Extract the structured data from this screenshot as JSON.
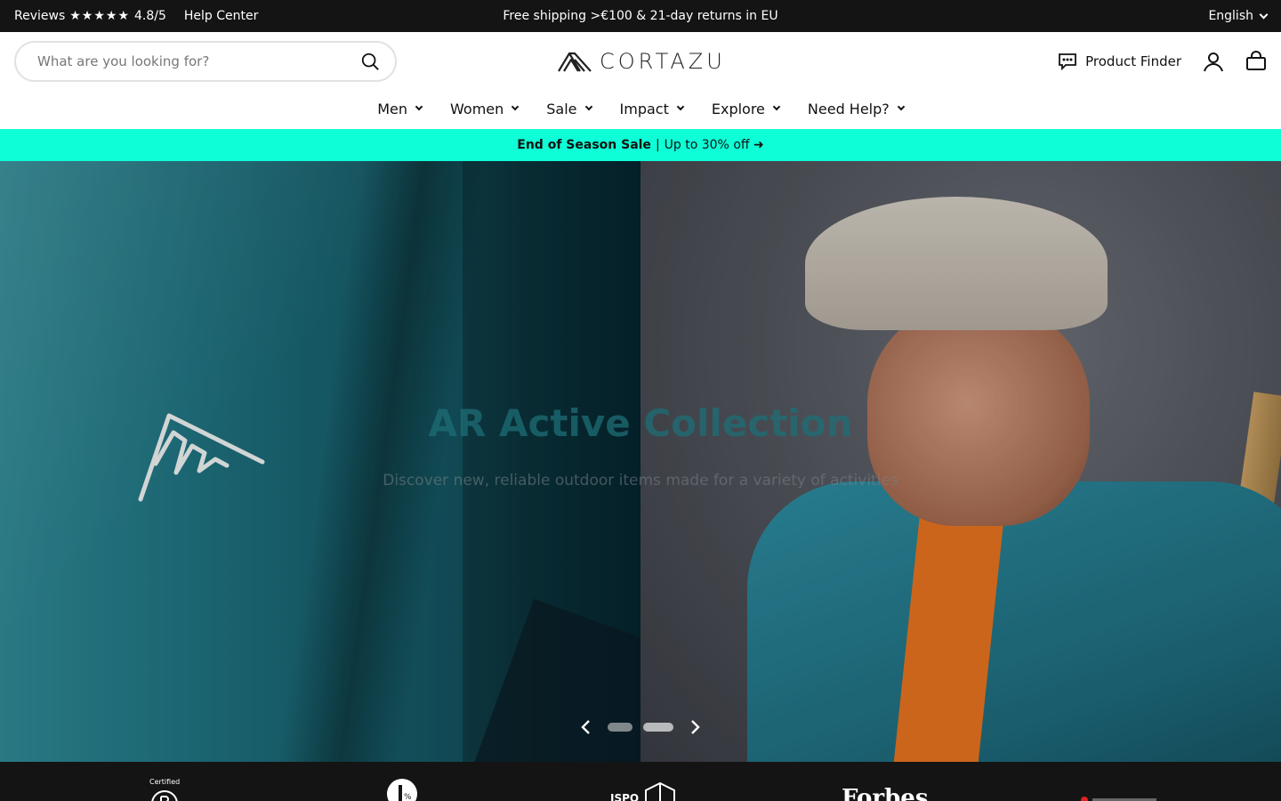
{
  "topbar": {
    "reviews_label": "Reviews",
    "stars": "★★★★★",
    "rating": "4.8/5",
    "help_center": "Help Center",
    "announcement": "Free shipping >€100 & 21-day returns in EU",
    "language": "English"
  },
  "header": {
    "search_placeholder": "What are you looking for?",
    "brand": "CORTAZU",
    "product_finder": "Product Finder"
  },
  "nav": {
    "items": [
      {
        "label": "Men"
      },
      {
        "label": "Women"
      },
      {
        "label": "Sale"
      },
      {
        "label": "Impact"
      },
      {
        "label": "Explore"
      },
      {
        "label": "Need Help?"
      }
    ]
  },
  "promo": {
    "bold": "End of Season Sale",
    "separator": "|",
    "rest": "Up to 30% off ➜"
  },
  "hero": {
    "title": "AR Active Collection",
    "subtitle": "Discover new, reliable outdoor items made for a variety of activities",
    "slides": 2,
    "active_slide": 2
  },
  "trust": {
    "bcorp_label": "Certified",
    "onepct_label": "%",
    "ispo_label": "ISPO",
    "forbes_label": "Forbes"
  },
  "colors": {
    "promo_bg": "#0effd7",
    "topbar_bg": "#141414"
  }
}
